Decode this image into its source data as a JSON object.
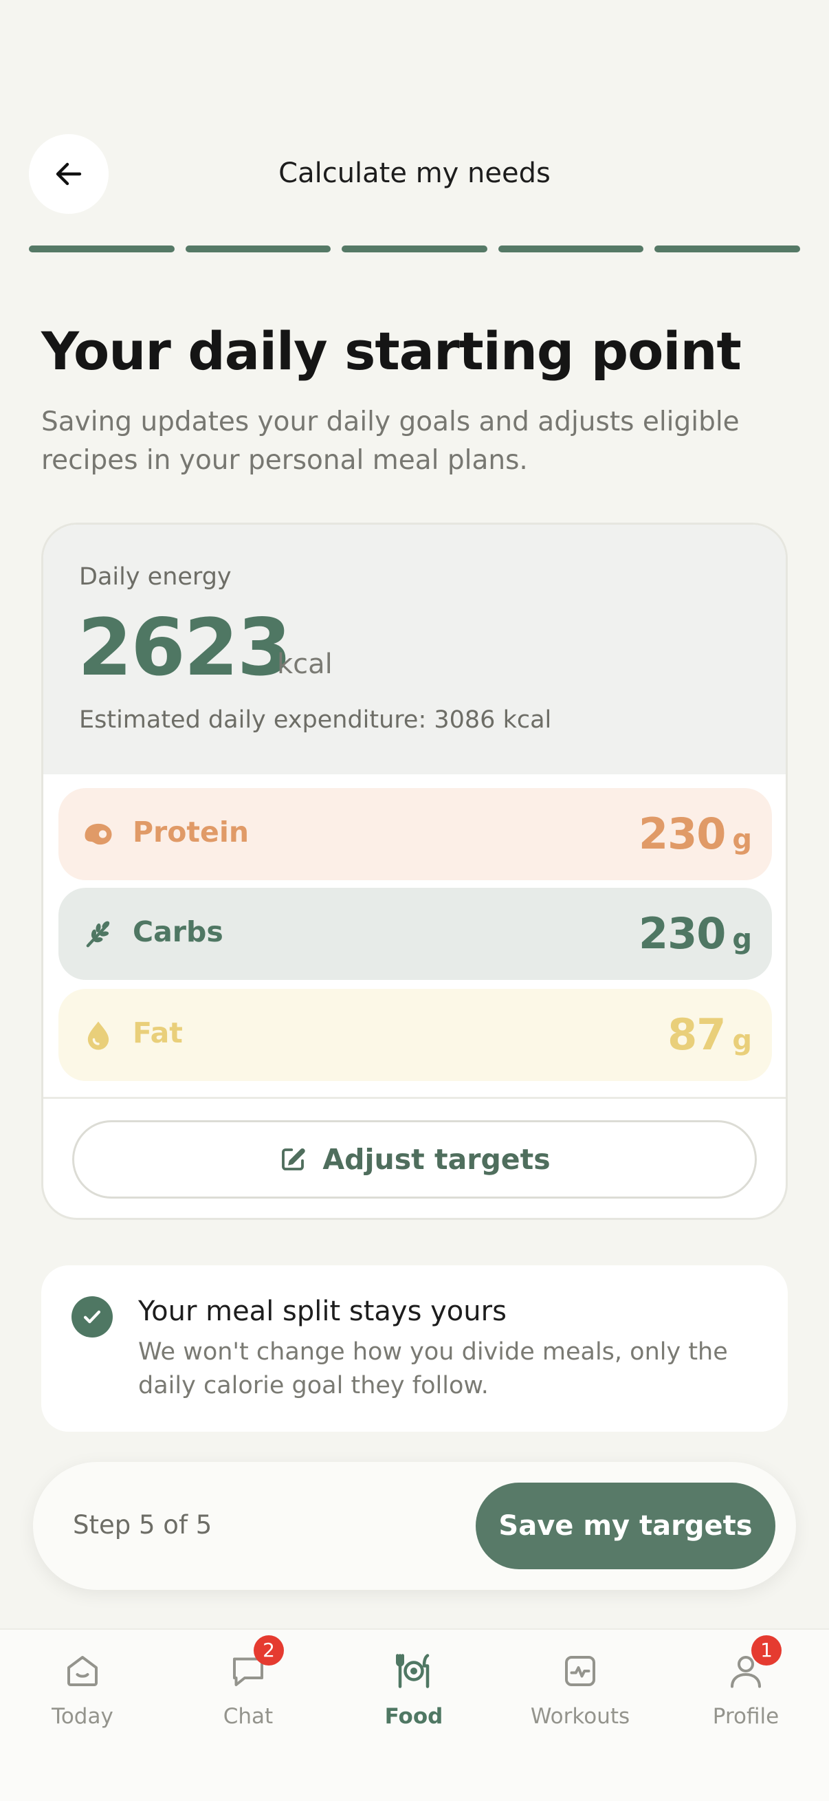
{
  "header": {
    "title": "Calculate my needs",
    "back_icon": "arrow-left-icon"
  },
  "progress": {
    "completed_steps": 5,
    "total_steps": 5
  },
  "intro": {
    "headline": "Your daily starting point",
    "subline": "Saving updates your daily goals and adjusts eligible recipes in your personal meal plans."
  },
  "energy": {
    "label": "Daily energy",
    "value": "2623",
    "unit": "kcal",
    "expenditure": "Estimated daily expenditure: 3086 kcal"
  },
  "macros": [
    {
      "label": "Protein",
      "value": "230",
      "unit": "g",
      "icon": "meat-icon",
      "color": "#e09a67"
    },
    {
      "label": "Carbs",
      "value": "230",
      "unit": "g",
      "icon": "wheat-icon",
      "color": "#4f7763"
    },
    {
      "label": "Fat",
      "value": "87",
      "unit": "g",
      "icon": "drop-icon",
      "color": "#e9cf7a"
    }
  ],
  "adjust_button": {
    "label": "Adjust targets",
    "icon": "edit-icon"
  },
  "info": {
    "title": "Your meal split stays yours",
    "text": "We won't change how you divide meals, only the daily calorie goal they follow.",
    "icon": "check-circle-icon"
  },
  "footer": {
    "step_text": "Step 5 of 5",
    "save_label": "Save my targets"
  },
  "tabs": [
    {
      "label": "Today",
      "icon": "home-icon",
      "active": false
    },
    {
      "label": "Chat",
      "icon": "chat-icon",
      "badge": "2",
      "active": false
    },
    {
      "label": "Food",
      "icon": "food-icon",
      "active": true
    },
    {
      "label": "Workouts",
      "icon": "activity-icon",
      "active": false
    },
    {
      "label": "Profile",
      "icon": "user-icon",
      "badge": "1",
      "active": false
    }
  ],
  "colors": {
    "accent": "#4f7763",
    "background": "#f5f5f0",
    "badge": "#e53b30"
  }
}
